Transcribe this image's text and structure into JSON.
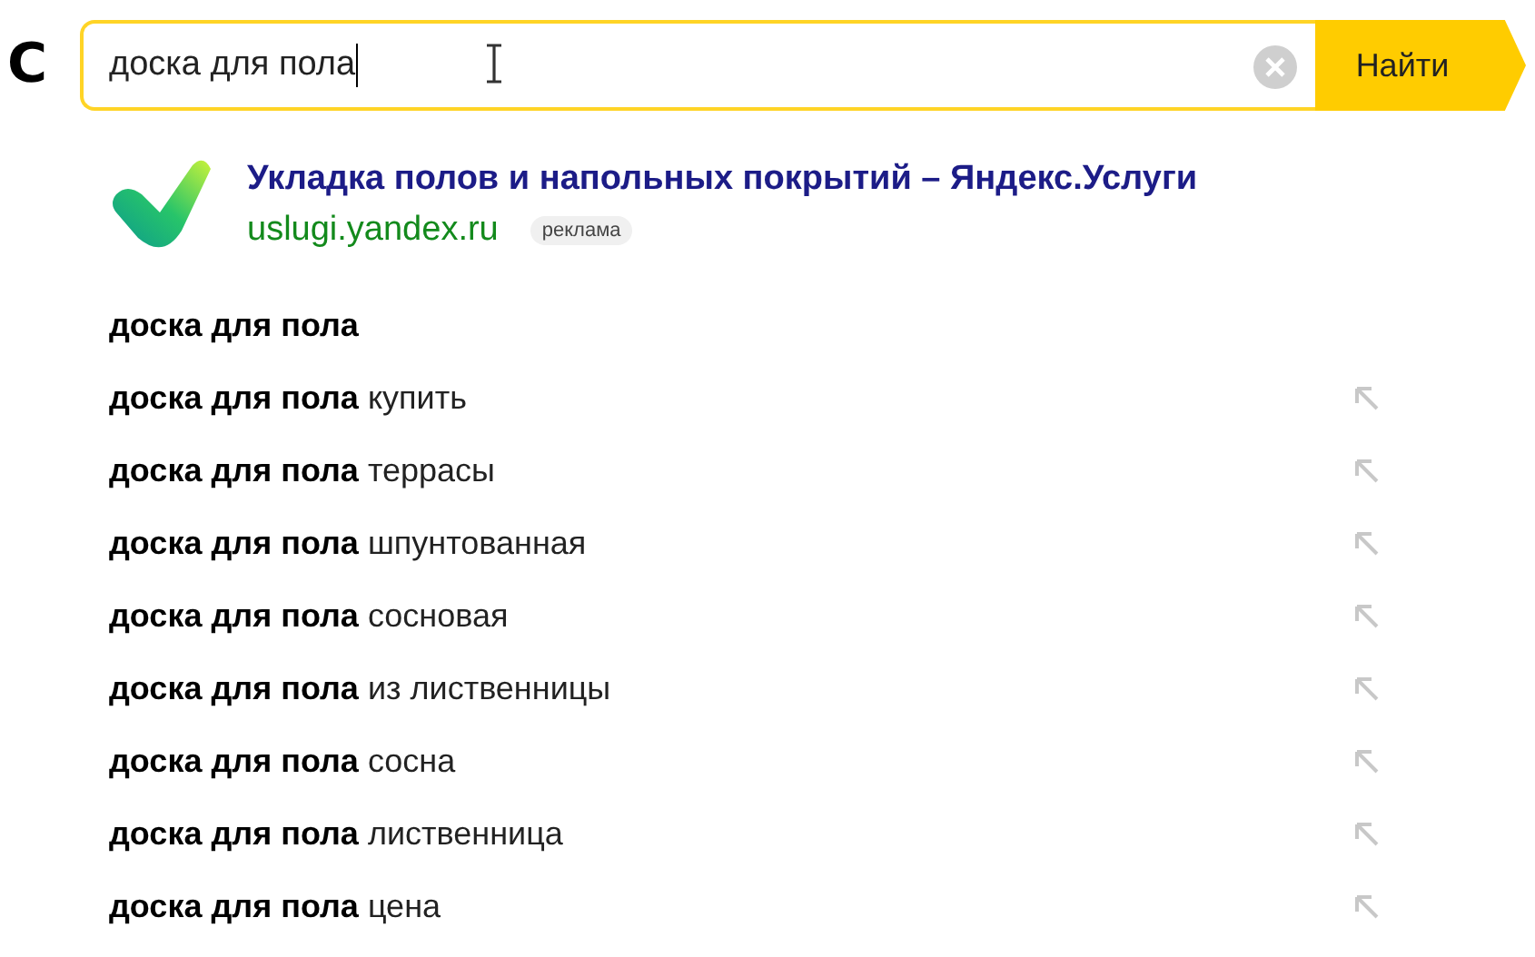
{
  "logo_fragment": "С",
  "search": {
    "value": "доска для пола",
    "submit": "Найти"
  },
  "ad": {
    "title": "Укладка полов и напольных покрытий – Яндекс.Услуги",
    "url": "uslugi.yandex.ru",
    "badge": "реклама"
  },
  "suggestions": [
    {
      "text": "**доска для пола**",
      "insert_arrow": false
    },
    {
      "text": "**доска для пола** купить",
      "insert_arrow": true
    },
    {
      "text": "**доска для пола** террасы",
      "insert_arrow": true
    },
    {
      "text": "**доска для пола** шпунтованная",
      "insert_arrow": true
    },
    {
      "text": "**доска для пола** сосновая",
      "insert_arrow": true
    },
    {
      "text": "**доска для пола** из лиственницы",
      "insert_arrow": true
    },
    {
      "text": "**доска для пола** сосна",
      "insert_arrow": true
    },
    {
      "text": "**доска для пола** лиственница",
      "insert_arrow": true
    },
    {
      "text": "**доска для пола** цена",
      "insert_arrow": true
    }
  ]
}
